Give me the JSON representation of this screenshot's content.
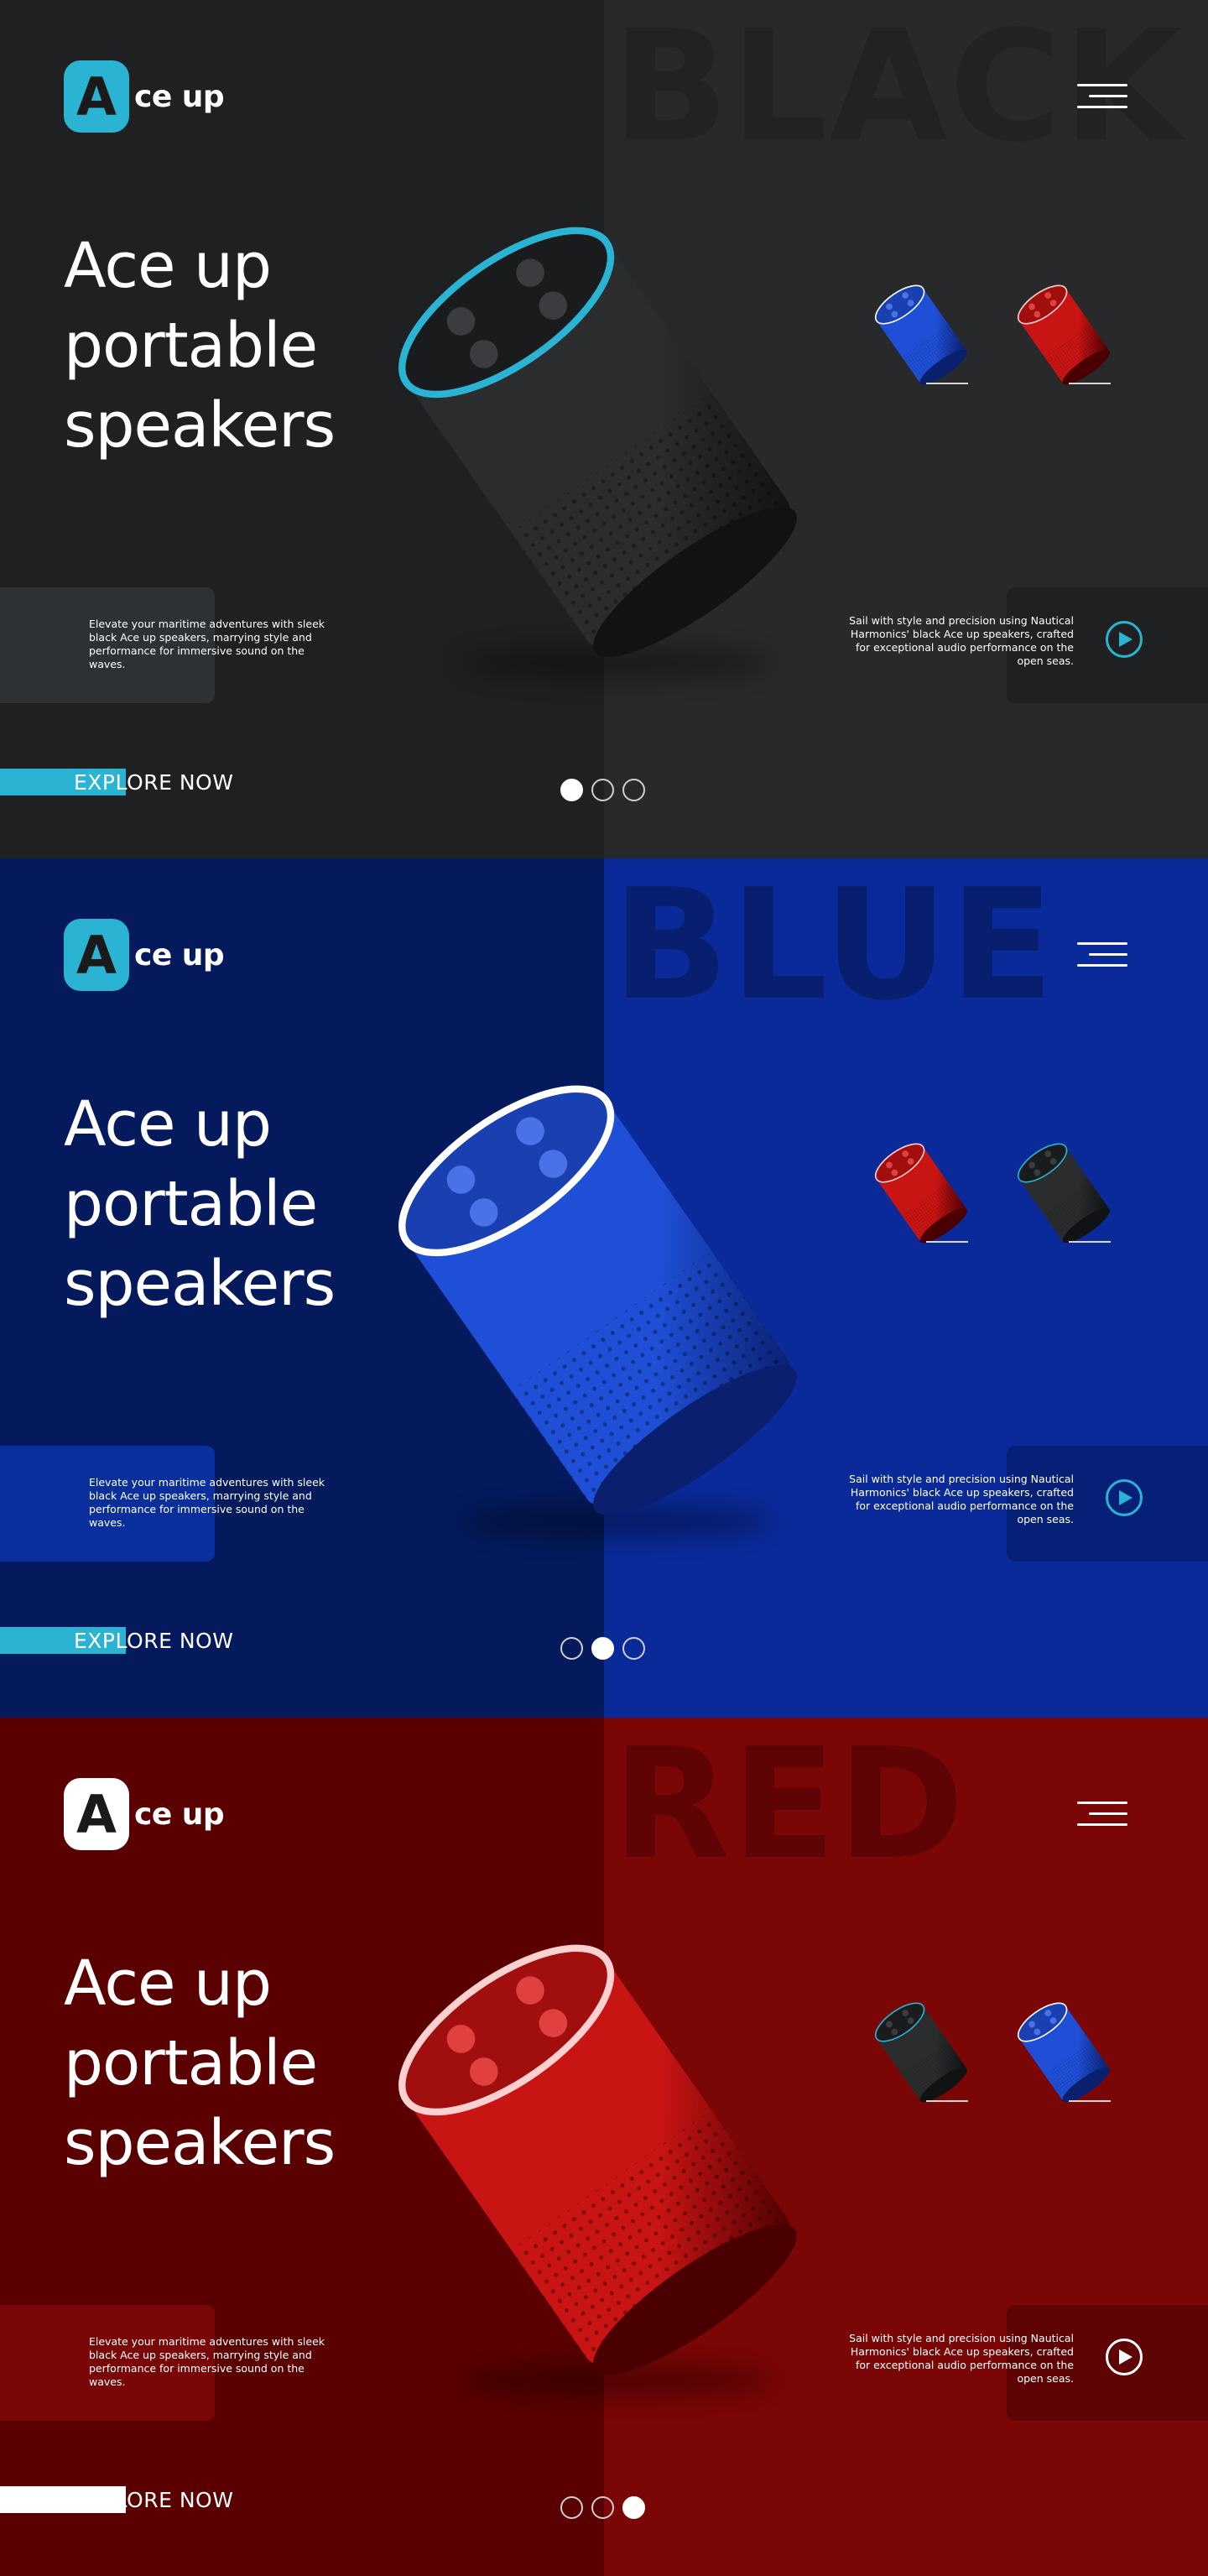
{
  "panels": [
    {
      "id": "black",
      "big_word": "BLACK",
      "logo_letter": "A",
      "logo_text": "ce up",
      "headline": [
        "Ace up",
        "portable",
        "speakers"
      ],
      "desc_left": "Elevate your maritime adventures with sleek black Ace up speakers, marrying style and performance for immersive sound on the waves.",
      "desc_right": "Sail with style and precision using Nautical Harmonics' black Ace up speakers, crafted for exceptional audio performance on the open seas.",
      "explore_label": "EXPLORE NOW",
      "active_dot": 0,
      "thumbs": [
        "blue",
        "red"
      ],
      "colors": {
        "left": "#1f2021",
        "right": "#27292b",
        "big_word": "#212223",
        "box": "#2e3133",
        "logo_bg": "#2bb3d3",
        "logo_fg": "#1a1a1a",
        "accent": "#2bb3d3",
        "bar": "#2bb3d3"
      }
    },
    {
      "id": "blue",
      "big_word": "BLUE",
      "logo_letter": "A",
      "logo_text": "ce up",
      "headline": [
        "Ace up",
        "portable",
        "speakers"
      ],
      "desc_left": "Elevate your maritime adventures with sleek black Ace up speakers, marrying style and performance for immersive sound on the waves.",
      "desc_right": "Sail with style and precision using Nautical Harmonics' black Ace up speakers, crafted for exceptional audio performance on the open seas.",
      "explore_label": "EXPLORE NOW",
      "active_dot": 1,
      "thumbs": [
        "red",
        "black"
      ],
      "colors": {
        "left": "#041a5c",
        "right": "#0a2a99",
        "big_word": "#071f6e",
        "box": "#0a2f9c",
        "logo_bg": "#2bb3d3",
        "logo_fg": "#1a1a1a",
        "accent": "#2bb3d3",
        "bar": "#2bb3d3"
      }
    },
    {
      "id": "red",
      "big_word": "RED",
      "logo_letter": "A",
      "logo_text": "ce up",
      "headline": [
        "Ace up",
        "portable",
        "speakers"
      ],
      "desc_left": "Elevate your maritime adventures with sleek black Ace up speakers, marrying style and performance for immersive sound on the waves.",
      "desc_right": "Sail with style and precision using Nautical Harmonics' black Ace up speakers, crafted for exceptional audio performance on the open seas.",
      "explore_label": "EXPLORE NOW",
      "active_dot": 2,
      "thumbs": [
        "black",
        "blue"
      ],
      "colors": {
        "left": "#5a0000",
        "right": "#7a0606",
        "big_word": "#5e0404",
        "box": "#790707",
        "logo_bg": "#ffffff",
        "logo_fg": "#1a1a1a",
        "accent": "#ffffff",
        "bar": "#ffffff"
      }
    }
  ],
  "speaker_colors": {
    "black": {
      "body": "#2a2c2e",
      "body_dark": "#111213",
      "top": "#1a1b1c",
      "ring": "#2bb3d3",
      "button": "#3a3c3f"
    },
    "blue": {
      "body": "#1e4fd6",
      "body_dark": "#0a1f6e",
      "top": "#1a3fb0",
      "ring": "#ffffff",
      "button": "#4a72e6"
    },
    "red": {
      "body": "#c91414",
      "body_dark": "#4a0000",
      "top": "#a00e0e",
      "ring": "#ffd0d0",
      "button": "#e04040"
    }
  }
}
